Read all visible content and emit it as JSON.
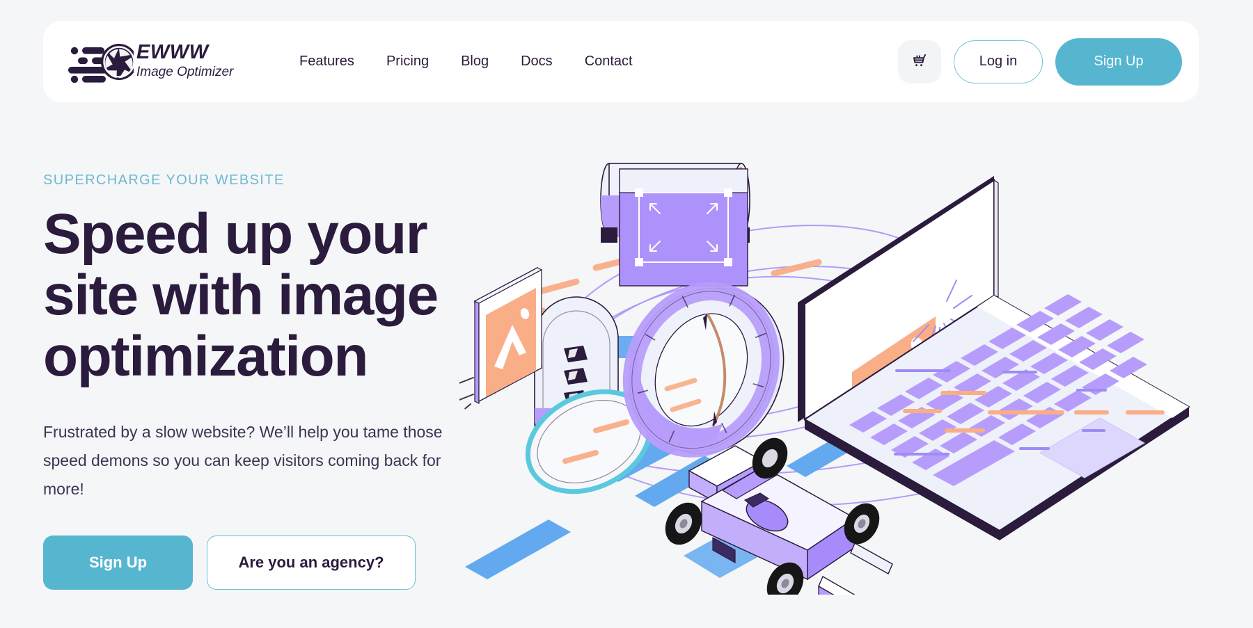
{
  "brand": {
    "logo_icon": "aperture-speed-icon",
    "name": "EWWW",
    "tagline": "Image Optimizer"
  },
  "nav": {
    "items": [
      {
        "label": "Features"
      },
      {
        "label": "Pricing"
      },
      {
        "label": "Blog"
      },
      {
        "label": "Docs"
      },
      {
        "label": "Contact"
      }
    ]
  },
  "header_actions": {
    "cart_icon": "shopping-cart-icon",
    "login_label": "Log in",
    "signup_label": "Sign Up"
  },
  "hero": {
    "eyebrow": "SUPERCHARGE YOUR WEBSITE",
    "headline": "Speed up your site with image optimization",
    "subcopy": "Frustrated by a slow website? We’ll help you tame those speed demons so you can keep visitors coming back for more!",
    "primary_cta": "Sign Up",
    "secondary_cta": "Are you an agency?",
    "illustration": "isometric-image-optimization-scene"
  },
  "colors": {
    "page_background": "#f5f6f8",
    "card_background": "#ffffff",
    "brand_dark": "#2b1b3d",
    "accent_teal": "#57b6cf",
    "eyebrow_teal": "#6cb9cf",
    "border_teal": "#6cc0d4",
    "illustration_purple": "#a78bfa",
    "illustration_peach": "#f9ae87",
    "illustration_blue": "#63a9ef"
  }
}
